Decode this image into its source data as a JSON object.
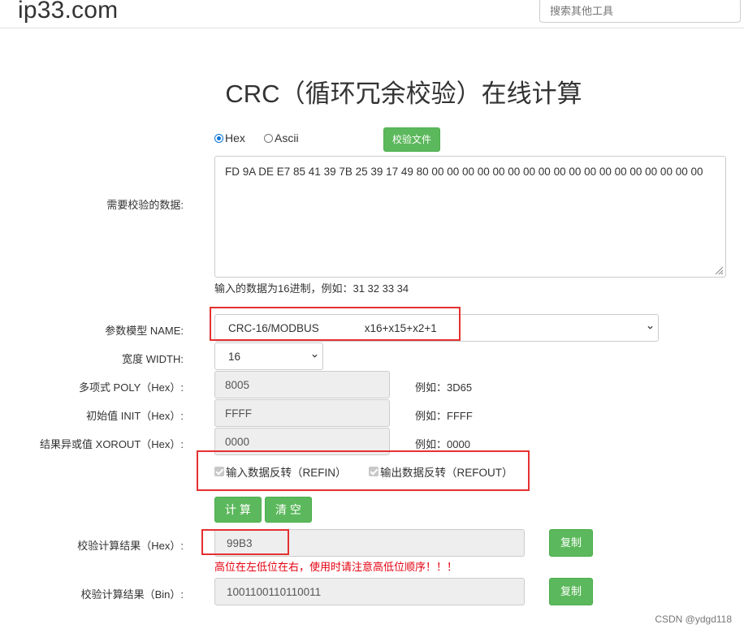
{
  "header": {
    "logo": "ip33.com",
    "search_placeholder": "搜索其他工具"
  },
  "title": "CRC（循环冗余校验）在线计算",
  "input": {
    "label": "需要校验的数据:",
    "format_options": [
      "Hex",
      "Ascii"
    ],
    "selected_format": "Hex",
    "file_button": "校验文件",
    "data_value": "FD 9A DE E7 85 41 39 7B 25 39 17 49 80 00 00 00 00 00 00 00 00 00 00 00 00 00 00 00 00 00 00",
    "hint": "输入的数据为16进制，例如：31 32 33 34"
  },
  "params": {
    "model_label": "参数模型 NAME:",
    "model_value": "CRC-16/MODBUS",
    "model_poly": "x16+x15+x2+1",
    "width_label": "宽度 WIDTH:",
    "width_value": "16",
    "poly_label": "多项式 POLY（Hex）:",
    "poly_value": "8005",
    "poly_example": "例如：3D65",
    "init_label": "初始值 INIT（Hex）:",
    "init_value": "FFFF",
    "init_example": "例如：FFFF",
    "xorout_label": "结果异或值 XOROUT（Hex）:",
    "xorout_value": "0000",
    "xorout_example": "例如：0000",
    "refin_label": "输入数据反转（REFIN）",
    "refin_checked": true,
    "refout_label": "输出数据反转（REFOUT）",
    "refout_checked": true
  },
  "actions": {
    "calculate": "计 算",
    "clear": "清 空"
  },
  "results": {
    "hex_label": "校验计算结果（Hex）:",
    "hex_value": "99B3",
    "copy_label": "复制",
    "warning": "高位在左低位在右，使用时请注意高低位顺序！！！",
    "bin_label": "校验计算结果（Bin）:",
    "bin_value": "1001100110110011"
  },
  "watermark": "CSDN @ydgd118",
  "colors": {
    "accent_green": "#5cb85c",
    "annotation_red": "#e53030",
    "warning_red": "#e4000f",
    "radio_blue": "#0a75d8"
  }
}
